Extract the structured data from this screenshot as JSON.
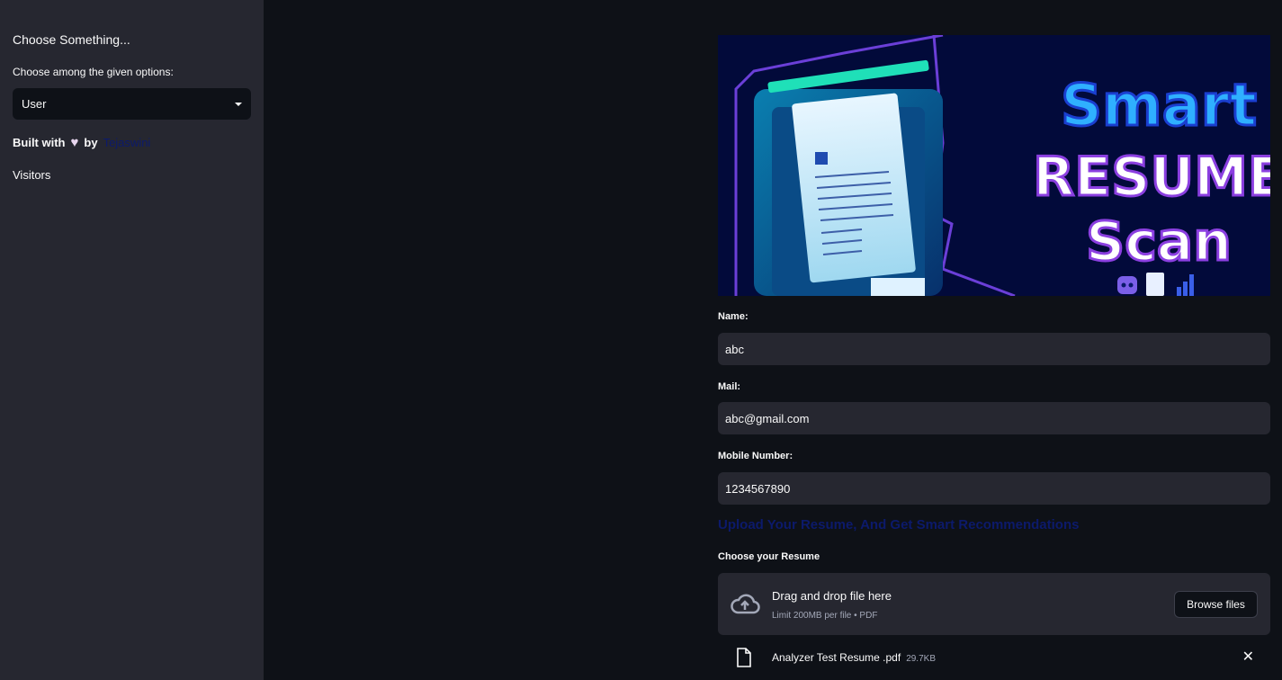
{
  "sidebar": {
    "title": "Choose Something...",
    "select_label": "Choose among the given options:",
    "select_value": "User",
    "built_with_prefix": "Built with",
    "built_with_by": "by",
    "author": "Tejaswini",
    "visitors": "Visitors"
  },
  "banner": {
    "line1": "Smart",
    "line2": "RESUME",
    "line3": "Scan"
  },
  "form": {
    "name_label": "Name:",
    "name_value": "abc",
    "mail_label": "Mail:",
    "mail_value": "abc@gmail.com",
    "mobile_label": "Mobile Number:",
    "mobile_value": "1234567890"
  },
  "upload": {
    "heading": "Upload Your Resume, And Get Smart Recommendations",
    "label": "Choose your Resume",
    "drop_title": "Drag and drop file here",
    "drop_sub": "Limit 200MB per file • PDF",
    "browse_label": "Browse files",
    "file_name": "Analyzer Test Resume .pdf",
    "file_size": "29.7KB"
  },
  "colors": {
    "background": "#0e1117",
    "sidebar": "#262730",
    "input": "#262730",
    "heading_link": "#0c1a6b"
  }
}
